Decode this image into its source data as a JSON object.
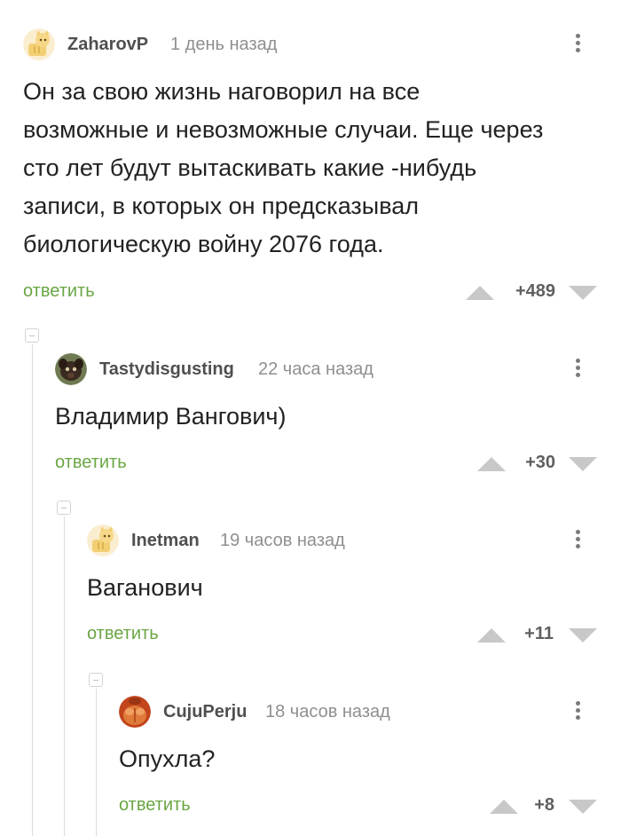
{
  "comments": [
    {
      "username": "ZaharovP",
      "time": "1 день назад",
      "avatar": "default-cat-avatar-icon",
      "text_lines": [
        "Он за свою жизнь наговорил на все",
        "возможные и невозможные случаи. Еще через",
        "сто лет будут вытаскивать какие -нибудь",
        "записи, в которых он предсказывал",
        "биологическую войну 2076 года."
      ],
      "reply_label": "ответить",
      "rating": "+489"
    },
    {
      "username": "Tastydisgusting",
      "time": "22 часа назад",
      "avatar": "puppy-photo-avatar",
      "text_lines": [
        "Владимир Вангович)"
      ],
      "reply_label": "ответить",
      "rating": "+30"
    },
    {
      "username": "Inetman",
      "time": "19 часов назад",
      "avatar": "default-cat-avatar-icon",
      "text_lines": [
        "Ваганович"
      ],
      "reply_label": "ответить",
      "rating": "+11"
    },
    {
      "username": "CujuPerju",
      "time": "18 часов назад",
      "avatar": "torso-photo-avatar",
      "text_lines": [
        "Опухла?"
      ],
      "reply_label": "ответить",
      "rating": "+8"
    }
  ],
  "colors": {
    "reply_green": "#6aa644",
    "vote_gray": "#c8c8c8",
    "thread_line": "#dcdcdc"
  }
}
